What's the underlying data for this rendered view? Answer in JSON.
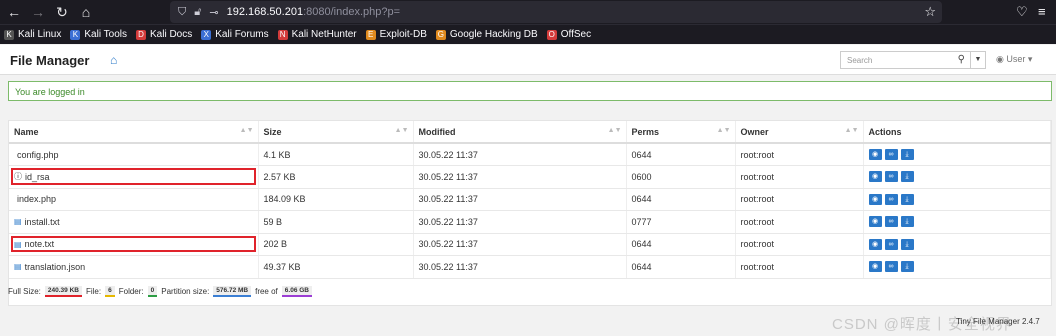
{
  "browser": {
    "url_host": "192.168.50.201",
    "url_rest": ":8080/index.php?p=",
    "bookmarks": [
      "Kali Linux",
      "Kali Tools",
      "Kali Docs",
      "Kali Forums",
      "Kali NetHunter",
      "Exploit-DB",
      "Google Hacking DB",
      "OffSec"
    ]
  },
  "header": {
    "title": "File Manager",
    "search_placeholder": "Search",
    "user_label": "User"
  },
  "alert": "You are logged in",
  "table": {
    "columns": [
      "Name",
      "Size",
      "Modified",
      "Perms",
      "Owner",
      "Actions"
    ],
    "rows": [
      {
        "name": "config.php",
        "size": "4.1 KB",
        "modified": "30.05.22 11:37",
        "perms": "0644",
        "owner": "root:root"
      },
      {
        "name": "id_rsa",
        "size": "2.57 KB",
        "modified": "30.05.22 11:37",
        "perms": "0600",
        "owner": "root:root"
      },
      {
        "name": "index.php",
        "size": "184.09 KB",
        "modified": "30.05.22 11:37",
        "perms": "0644",
        "owner": "root:root"
      },
      {
        "name": "install.txt",
        "size": "59 B",
        "modified": "30.05.22 11:37",
        "perms": "0777",
        "owner": "root:root"
      },
      {
        "name": "note.txt",
        "size": "202 B",
        "modified": "30.05.22 11:37",
        "perms": "0644",
        "owner": "root:root"
      },
      {
        "name": "translation.json",
        "size": "49.37 KB",
        "modified": "30.05.22 11:37",
        "perms": "0644",
        "owner": "root:root"
      }
    ]
  },
  "footer": {
    "full_size_label": "Full Size:",
    "full_size": "240.39 KB",
    "file_label": "File:",
    "file_count": "6",
    "folder_label": "Folder:",
    "folder_count": "0",
    "partition_label": "Partition size:",
    "partition": "576.72 MB",
    "free_label": "free of",
    "free": "6.06 GB"
  },
  "watermark": "CSDN @晖度丨安全视界",
  "watermark2": "Tiny File Manager 2.4.7"
}
